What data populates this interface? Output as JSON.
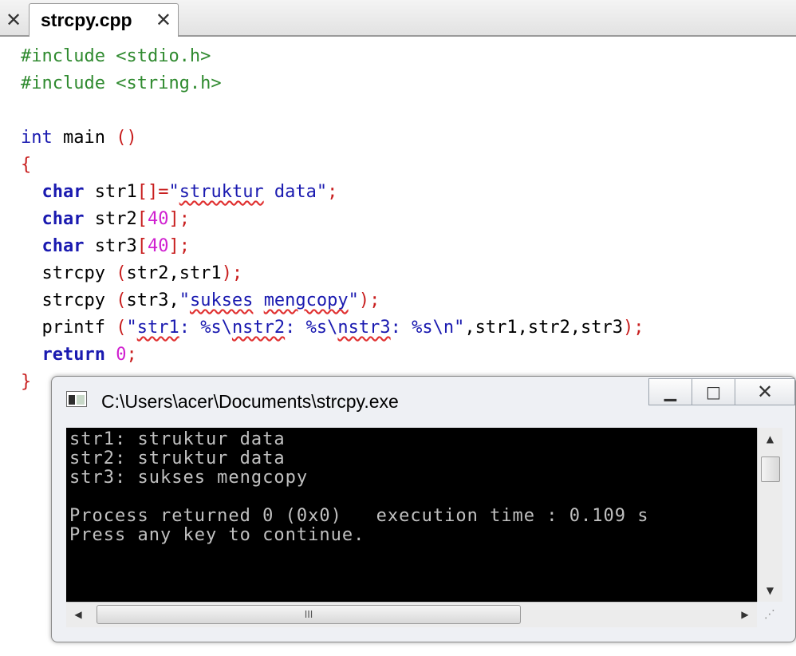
{
  "editor": {
    "close_all_glyph": "✕",
    "tab": {
      "label": "strcpy.cpp",
      "close_glyph": "✕"
    },
    "code": {
      "line1_directive": "#include",
      "line1_header": " <stdio.h>",
      "line2_directive": "#include",
      "line2_header": " <string.h>",
      "line4_type": "int",
      "line4_name": " main ",
      "line4_parens": "()",
      "line5_brace": "{",
      "line6_type": "char",
      "line6_var": " str1",
      "line6_op": "[]=",
      "line6_quote_open": "\"",
      "line6_word1": "struktur",
      "line6_word2": " data",
      "line6_quote_close": "\"",
      "line6_end": ";",
      "line7_type": "char",
      "line7_var": " str2",
      "line7_open": "[",
      "line7_num": "40",
      "line7_close": "];",
      "line8_type": "char",
      "line8_var": " str3",
      "line8_open": "[",
      "line8_num": "40",
      "line8_close": "];",
      "line9_fn": "strcpy ",
      "line9_open": "(",
      "line9_args": "str2,str1",
      "line9_close": ");",
      "line10_fn": "strcpy ",
      "line10_open": "(",
      "line10_arg": "str3,",
      "line10_quote_open": "\"",
      "line10_word1": "sukses",
      "line10_space": " ",
      "line10_word2": "mengcopy",
      "line10_quote_close": "\"",
      "line10_close": ");",
      "line11_fn": "printf ",
      "line11_open": "(",
      "line11_quote_open": "\"",
      "line11_w1": "str1",
      "line11_t1": ": %s\\",
      "line11_w2": "nstr2",
      "line11_t2": ": %s\\",
      "line11_w3": "nstr3",
      "line11_t3": ": %s\\n\"",
      "line11_args": ",str1,str2,str3",
      "line11_close": ");",
      "line12_kw": "return",
      "line12_sp": " ",
      "line12_num": "0",
      "line12_end": ";",
      "line13_brace": "}"
    }
  },
  "console_window": {
    "title": "C:\\Users\\acer\\Documents\\strcpy.exe",
    "minimize_glyph": "▁",
    "maximize_glyph": "□",
    "close_glyph": "✕",
    "output": {
      "line1": "str1: struktur data",
      "line2": "str2: struktur data",
      "line3": "str3: sukses mengcopy",
      "line4": "",
      "line5": "Process returned 0 (0x0)   execution time : 0.109 s",
      "line6": "Press any key to continue."
    },
    "scroll_up_glyph": "▲",
    "scroll_down_glyph": "▼",
    "scroll_left_glyph": "◀",
    "scroll_right_glyph": "▶",
    "hthumb_grip": "III",
    "resize_grip": "⋰"
  }
}
